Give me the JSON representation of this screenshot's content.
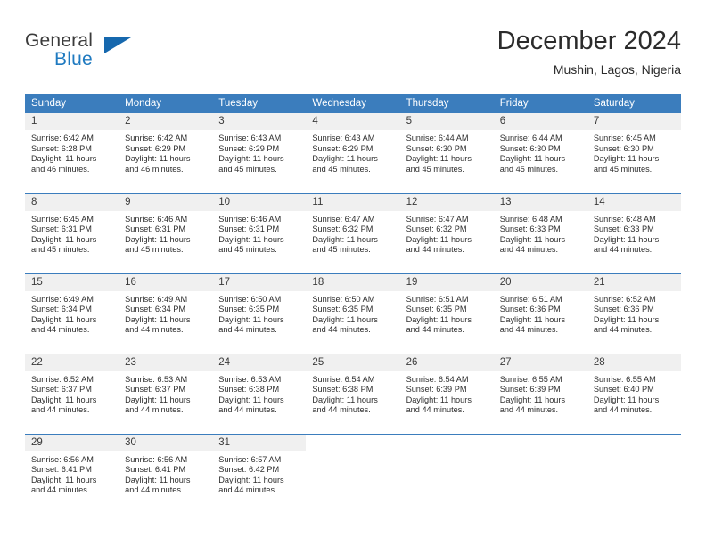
{
  "brand": {
    "name_part1": "General",
    "name_part2": "Blue",
    "triangle_color": "#1668ae",
    "blue_color": "#1f7ac0"
  },
  "header": {
    "title": "December 2024",
    "subtitle": "Mushin, Lagos, Nigeria"
  },
  "theme": {
    "header_bg": "#3b7dbd",
    "daynum_bg": "#f0f0f0",
    "row_divider": "#3b7dbd",
    "text": "#2d2d2d"
  },
  "calendar": {
    "day_headers": [
      "Sunday",
      "Monday",
      "Tuesday",
      "Wednesday",
      "Thursday",
      "Friday",
      "Saturday"
    ],
    "weeks": [
      [
        {
          "day": "1",
          "sunrise": "Sunrise: 6:42 AM",
          "sunset": "Sunset: 6:28 PM",
          "daylight1": "Daylight: 11 hours",
          "daylight2": "and 46 minutes."
        },
        {
          "day": "2",
          "sunrise": "Sunrise: 6:42 AM",
          "sunset": "Sunset: 6:29 PM",
          "daylight1": "Daylight: 11 hours",
          "daylight2": "and 46 minutes."
        },
        {
          "day": "3",
          "sunrise": "Sunrise: 6:43 AM",
          "sunset": "Sunset: 6:29 PM",
          "daylight1": "Daylight: 11 hours",
          "daylight2": "and 45 minutes."
        },
        {
          "day": "4",
          "sunrise": "Sunrise: 6:43 AM",
          "sunset": "Sunset: 6:29 PM",
          "daylight1": "Daylight: 11 hours",
          "daylight2": "and 45 minutes."
        },
        {
          "day": "5",
          "sunrise": "Sunrise: 6:44 AM",
          "sunset": "Sunset: 6:30 PM",
          "daylight1": "Daylight: 11 hours",
          "daylight2": "and 45 minutes."
        },
        {
          "day": "6",
          "sunrise": "Sunrise: 6:44 AM",
          "sunset": "Sunset: 6:30 PM",
          "daylight1": "Daylight: 11 hours",
          "daylight2": "and 45 minutes."
        },
        {
          "day": "7",
          "sunrise": "Sunrise: 6:45 AM",
          "sunset": "Sunset: 6:30 PM",
          "daylight1": "Daylight: 11 hours",
          "daylight2": "and 45 minutes."
        }
      ],
      [
        {
          "day": "8",
          "sunrise": "Sunrise: 6:45 AM",
          "sunset": "Sunset: 6:31 PM",
          "daylight1": "Daylight: 11 hours",
          "daylight2": "and 45 minutes."
        },
        {
          "day": "9",
          "sunrise": "Sunrise: 6:46 AM",
          "sunset": "Sunset: 6:31 PM",
          "daylight1": "Daylight: 11 hours",
          "daylight2": "and 45 minutes."
        },
        {
          "day": "10",
          "sunrise": "Sunrise: 6:46 AM",
          "sunset": "Sunset: 6:31 PM",
          "daylight1": "Daylight: 11 hours",
          "daylight2": "and 45 minutes."
        },
        {
          "day": "11",
          "sunrise": "Sunrise: 6:47 AM",
          "sunset": "Sunset: 6:32 PM",
          "daylight1": "Daylight: 11 hours",
          "daylight2": "and 45 minutes."
        },
        {
          "day": "12",
          "sunrise": "Sunrise: 6:47 AM",
          "sunset": "Sunset: 6:32 PM",
          "daylight1": "Daylight: 11 hours",
          "daylight2": "and 44 minutes."
        },
        {
          "day": "13",
          "sunrise": "Sunrise: 6:48 AM",
          "sunset": "Sunset: 6:33 PM",
          "daylight1": "Daylight: 11 hours",
          "daylight2": "and 44 minutes."
        },
        {
          "day": "14",
          "sunrise": "Sunrise: 6:48 AM",
          "sunset": "Sunset: 6:33 PM",
          "daylight1": "Daylight: 11 hours",
          "daylight2": "and 44 minutes."
        }
      ],
      [
        {
          "day": "15",
          "sunrise": "Sunrise: 6:49 AM",
          "sunset": "Sunset: 6:34 PM",
          "daylight1": "Daylight: 11 hours",
          "daylight2": "and 44 minutes."
        },
        {
          "day": "16",
          "sunrise": "Sunrise: 6:49 AM",
          "sunset": "Sunset: 6:34 PM",
          "daylight1": "Daylight: 11 hours",
          "daylight2": "and 44 minutes."
        },
        {
          "day": "17",
          "sunrise": "Sunrise: 6:50 AM",
          "sunset": "Sunset: 6:35 PM",
          "daylight1": "Daylight: 11 hours",
          "daylight2": "and 44 minutes."
        },
        {
          "day": "18",
          "sunrise": "Sunrise: 6:50 AM",
          "sunset": "Sunset: 6:35 PM",
          "daylight1": "Daylight: 11 hours",
          "daylight2": "and 44 minutes."
        },
        {
          "day": "19",
          "sunrise": "Sunrise: 6:51 AM",
          "sunset": "Sunset: 6:35 PM",
          "daylight1": "Daylight: 11 hours",
          "daylight2": "and 44 minutes."
        },
        {
          "day": "20",
          "sunrise": "Sunrise: 6:51 AM",
          "sunset": "Sunset: 6:36 PM",
          "daylight1": "Daylight: 11 hours",
          "daylight2": "and 44 minutes."
        },
        {
          "day": "21",
          "sunrise": "Sunrise: 6:52 AM",
          "sunset": "Sunset: 6:36 PM",
          "daylight1": "Daylight: 11 hours",
          "daylight2": "and 44 minutes."
        }
      ],
      [
        {
          "day": "22",
          "sunrise": "Sunrise: 6:52 AM",
          "sunset": "Sunset: 6:37 PM",
          "daylight1": "Daylight: 11 hours",
          "daylight2": "and 44 minutes."
        },
        {
          "day": "23",
          "sunrise": "Sunrise: 6:53 AM",
          "sunset": "Sunset: 6:37 PM",
          "daylight1": "Daylight: 11 hours",
          "daylight2": "and 44 minutes."
        },
        {
          "day": "24",
          "sunrise": "Sunrise: 6:53 AM",
          "sunset": "Sunset: 6:38 PM",
          "daylight1": "Daylight: 11 hours",
          "daylight2": "and 44 minutes."
        },
        {
          "day": "25",
          "sunrise": "Sunrise: 6:54 AM",
          "sunset": "Sunset: 6:38 PM",
          "daylight1": "Daylight: 11 hours",
          "daylight2": "and 44 minutes."
        },
        {
          "day": "26",
          "sunrise": "Sunrise: 6:54 AM",
          "sunset": "Sunset: 6:39 PM",
          "daylight1": "Daylight: 11 hours",
          "daylight2": "and 44 minutes."
        },
        {
          "day": "27",
          "sunrise": "Sunrise: 6:55 AM",
          "sunset": "Sunset: 6:39 PM",
          "daylight1": "Daylight: 11 hours",
          "daylight2": "and 44 minutes."
        },
        {
          "day": "28",
          "sunrise": "Sunrise: 6:55 AM",
          "sunset": "Sunset: 6:40 PM",
          "daylight1": "Daylight: 11 hours",
          "daylight2": "and 44 minutes."
        }
      ],
      [
        {
          "day": "29",
          "sunrise": "Sunrise: 6:56 AM",
          "sunset": "Sunset: 6:41 PM",
          "daylight1": "Daylight: 11 hours",
          "daylight2": "and 44 minutes."
        },
        {
          "day": "30",
          "sunrise": "Sunrise: 6:56 AM",
          "sunset": "Sunset: 6:41 PM",
          "daylight1": "Daylight: 11 hours",
          "daylight2": "and 44 minutes."
        },
        {
          "day": "31",
          "sunrise": "Sunrise: 6:57 AM",
          "sunset": "Sunset: 6:42 PM",
          "daylight1": "Daylight: 11 hours",
          "daylight2": "and 44 minutes."
        },
        {
          "day": "",
          "sunrise": "",
          "sunset": "",
          "daylight1": "",
          "daylight2": ""
        },
        {
          "day": "",
          "sunrise": "",
          "sunset": "",
          "daylight1": "",
          "daylight2": ""
        },
        {
          "day": "",
          "sunrise": "",
          "sunset": "",
          "daylight1": "",
          "daylight2": ""
        },
        {
          "day": "",
          "sunrise": "",
          "sunset": "",
          "daylight1": "",
          "daylight2": ""
        }
      ]
    ]
  }
}
